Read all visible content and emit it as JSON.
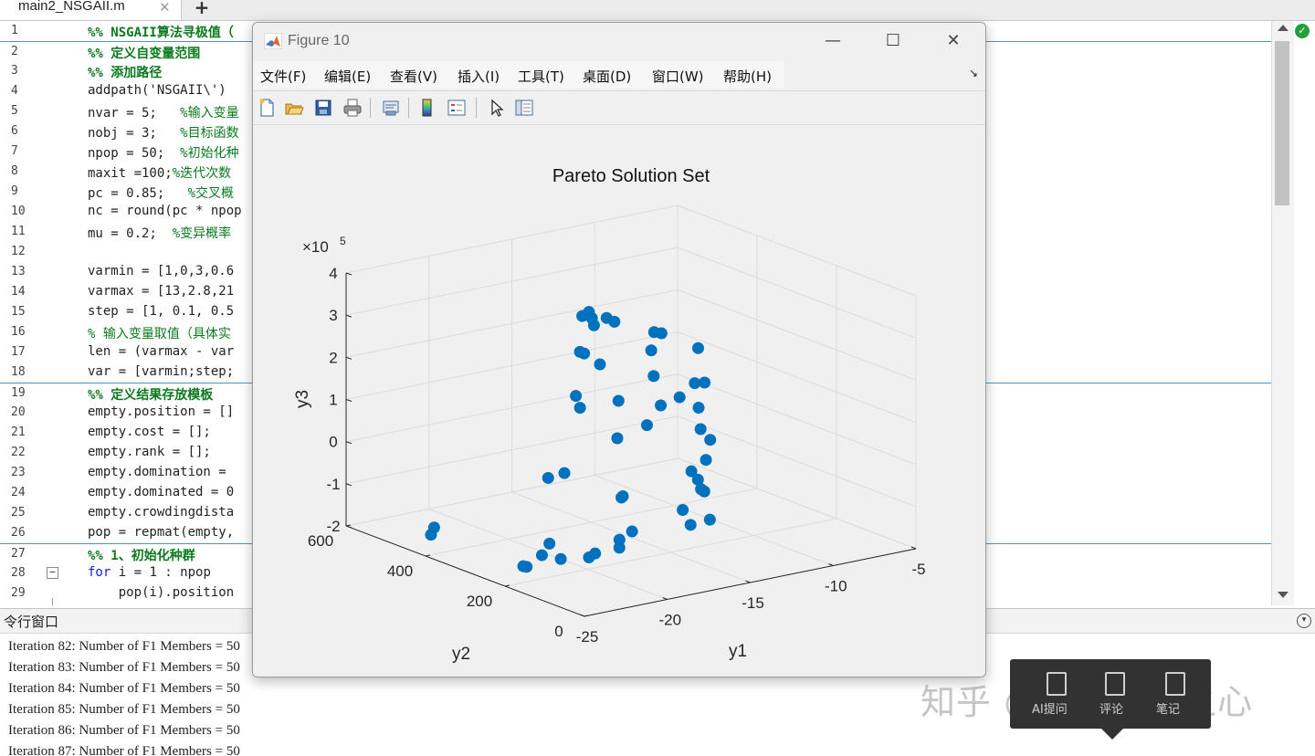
{
  "editor": {
    "tab_label": "main2_NSGAII.m",
    "tab_close": "✕",
    "tab_add": "+",
    "lines": [
      {
        "n": "1",
        "kind": "sec",
        "text": "%% NSGAII算法寻极值（"
      },
      {
        "n": "2",
        "kind": "sec",
        "text": "%% 定义自变量范围"
      },
      {
        "n": "3",
        "kind": "sec",
        "text": "%% 添加路径"
      },
      {
        "n": "4",
        "kind": "code",
        "text": "addpath('NSGAII\\')"
      },
      {
        "n": "5",
        "kind": "code",
        "text": "nvar = 5;   %输入变量"
      },
      {
        "n": "6",
        "kind": "code",
        "text": "nobj = 3;   %目标函数"
      },
      {
        "n": "7",
        "kind": "code",
        "text": "npop = 50;  %初始化种"
      },
      {
        "n": "8",
        "kind": "code",
        "text": "maxit =100;%迭代次数"
      },
      {
        "n": "9",
        "kind": "code",
        "text": "pc = 0.85;   %交叉概"
      },
      {
        "n": "10",
        "kind": "code",
        "text": "nc = round(pc * npop"
      },
      {
        "n": "11",
        "kind": "code",
        "text": "mu = 0.2;  %变异概率"
      },
      {
        "n": "12",
        "kind": "code",
        "text": ""
      },
      {
        "n": "13",
        "kind": "code",
        "text": "varmin = [1,0,3,0.6"
      },
      {
        "n": "14",
        "kind": "code",
        "text": "varmax = [13,2.8,21"
      },
      {
        "n": "15",
        "kind": "code",
        "text": "step = [1, 0.1, 0.5"
      },
      {
        "n": "16",
        "kind": "cmt",
        "text": "% 输入变量取值（具体实"
      },
      {
        "n": "17",
        "kind": "code",
        "text": "len = (varmax - var"
      },
      {
        "n": "18",
        "kind": "code",
        "text": "var = [varmin;step;"
      },
      {
        "n": "19",
        "kind": "sec",
        "text": "%% 定义结果存放模板"
      },
      {
        "n": "20",
        "kind": "code",
        "text": "empty.position = []"
      },
      {
        "n": "21",
        "kind": "code",
        "text": "empty.cost = [];"
      },
      {
        "n": "22",
        "kind": "code",
        "text": "empty.rank = [];"
      },
      {
        "n": "23",
        "kind": "code",
        "text": "empty.domination = "
      },
      {
        "n": "24",
        "kind": "code",
        "text": "empty.dominated = 0"
      },
      {
        "n": "25",
        "kind": "code",
        "text": "empty.crowdingdista"
      },
      {
        "n": "26",
        "kind": "code",
        "text": "pop = repmat(empty,"
      },
      {
        "n": "27",
        "kind": "sec",
        "text": "%% 1、初始化种群"
      },
      {
        "n": "28",
        "kind": "for",
        "kw": "for",
        "text": " i = 1 : npop"
      },
      {
        "n": "29",
        "kind": "code",
        "text": "    pop(i).position"
      }
    ]
  },
  "command_window": {
    "title": "令行窗口",
    "lines": [
      "Iteration 82: Number of F1 Members = 50",
      "Iteration 83: Number of F1 Members = 50",
      "Iteration 84: Number of F1 Members = 50",
      "Iteration 85: Number of F1 Members = 50",
      "Iteration 86: Number of F1 Members = 50",
      "Iteration 87: Number of F1 Members = 50"
    ]
  },
  "figure": {
    "title": "Figure 10",
    "minimize": "—",
    "maximize": "☐",
    "close": "✕",
    "menus": [
      "文件(F)",
      "编辑(E)",
      "查看(V)",
      "插入(I)",
      "工具(T)",
      "桌面(D)",
      "窗口(W)",
      "帮助(H)"
    ],
    "dock_glyph": "↘",
    "toolbar": [
      "new-figure-icon",
      "open-file-icon",
      "save-icon",
      "print-icon",
      "link-plot-icon",
      "colorbar-icon",
      "legend-icon",
      "select-pointer-icon",
      "property-inspector-icon"
    ]
  },
  "chart_data": {
    "type": "scatter",
    "title": "Pareto Solution Set",
    "xlabel": "y1",
    "ylabel": "y2",
    "zlabel": "y3",
    "z_exponent_label": "×10",
    "z_exponent": "5",
    "xlim": [
      -25,
      -5
    ],
    "ylim": [
      0,
      600
    ],
    "zlim": [
      -200000,
      400000
    ],
    "x_ticks": [
      "-25",
      "-20",
      "-15",
      "-10",
      "-5"
    ],
    "y_ticks": [
      "0",
      "200",
      "400",
      "600"
    ],
    "z_ticks": [
      "-2",
      "-1",
      "0",
      "1",
      "2",
      "3",
      "4"
    ],
    "grid": true,
    "marker_color": "#0072bd",
    "points": [
      {
        "x": -14.4,
        "y": 431,
        "z": 283000
      },
      {
        "x": -14.1,
        "y": 436,
        "z": 264000
      },
      {
        "x": -14.3,
        "y": 452,
        "z": 265000
      },
      {
        "x": -13.5,
        "y": 424,
        "z": 264000
      },
      {
        "x": -13.1,
        "y": 421,
        "z": 253000
      },
      {
        "x": -11.4,
        "y": 392,
        "z": 225000
      },
      {
        "x": -11.1,
        "y": 386,
        "z": 222000
      },
      {
        "x": -13.4,
        "y": 460,
        "z": 233000
      },
      {
        "x": -9.8,
        "y": 348,
        "z": 190000
      },
      {
        "x": -11.0,
        "y": 416,
        "z": 170000
      },
      {
        "x": -13.3,
        "y": 489,
        "z": 155000
      },
      {
        "x": -13.6,
        "y": 487,
        "z": 162000
      },
      {
        "x": -9.5,
        "y": 369,
        "z": 97000
      },
      {
        "x": -9.1,
        "y": 361,
        "z": 98000
      },
      {
        "x": -13.7,
        "y": 493,
        "z": 56000
      },
      {
        "x": -13.5,
        "y": 491,
        "z": 27000
      },
      {
        "x": -10.2,
        "y": 378,
        "z": 66000
      },
      {
        "x": -12.4,
        "y": 440,
        "z": 53000
      },
      {
        "x": -11.0,
        "y": 392,
        "z": 48000
      },
      {
        "x": -9.1,
        "y": 376,
        "z": 33000
      },
      {
        "x": -9.1,
        "y": 371,
        "z": -16000
      },
      {
        "x": -11.4,
        "y": 410,
        "z": -2000
      },
      {
        "x": -12.4,
        "y": 443,
        "z": -37000
      },
      {
        "x": -9.0,
        "y": 351,
        "z": -35000
      },
      {
        "x": -8.8,
        "y": 370,
        "z": -91000
      },
      {
        "x": -9.2,
        "y": 390,
        "z": -122000
      },
      {
        "x": -8.9,
        "y": 386,
        "z": -143000
      },
      {
        "x": -8.9,
        "y": 370,
        "z": -165000
      },
      {
        "x": -9.7,
        "y": 391,
        "z": -210000
      },
      {
        "x": -11.9,
        "y": 450,
        "z": -181000
      },
      {
        "x": -13.1,
        "y": 547,
        "z": -151000
      },
      {
        "x": -14.2,
        "y": 542,
        "z": -152000
      },
      {
        "x": -12.7,
        "y": 420,
        "z": -167000
      },
      {
        "x": -9.1,
        "y": 370,
        "z": -158000
      },
      {
        "x": -8.9,
        "y": 356,
        "z": -227000
      },
      {
        "x": -9.8,
        "y": 367,
        "z": -236000
      },
      {
        "x": -12.3,
        "y": 410,
        "z": -247000
      },
      {
        "x": -13.3,
        "y": 400,
        "z": -255000
      },
      {
        "x": -14.0,
        "y": 371,
        "z": -258000
      },
      {
        "x": -15.2,
        "y": 382,
        "z": -266000
      },
      {
        "x": -15.5,
        "y": 385,
        "z": -274000
      },
      {
        "x": -16.6,
        "y": 410,
        "z": -278000
      },
      {
        "x": -18.4,
        "y": 421,
        "z": -286000
      },
      {
        "x": -18.6,
        "y": 421,
        "z": -283000
      },
      {
        "x": -16.9,
        "y": 445,
        "z": -279000
      },
      {
        "x": -15.8,
        "y": 472,
        "z": -270000
      },
      {
        "x": -19.4,
        "y": 612,
        "z": -253000
      },
      {
        "x": -19.4,
        "y": 620,
        "z": -273000
      },
      {
        "x": -10.9,
        "y": 414,
        "z": 109000
      },
      {
        "x": -12.8,
        "y": 470,
        "z": 132000
      }
    ]
  },
  "overlay": {
    "tooltip_labels": [
      "AI提问",
      "评论",
      "笔记"
    ],
    "watermark": "知乎 @机器学习之心"
  }
}
